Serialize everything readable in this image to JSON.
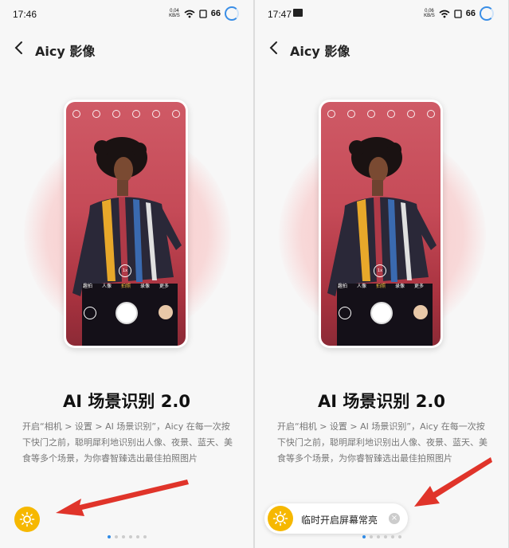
{
  "screens": [
    {
      "status": {
        "time": "17:46",
        "speed_value": "0.04",
        "speed_unit": "KB/S",
        "battery": "66"
      },
      "header": {
        "title": "Aicy 影像"
      },
      "phone_ui": {
        "modes": [
          "趣拍",
          "人像",
          "拍照",
          "录像",
          "更多"
        ],
        "active_mode": "拍照",
        "zoom": "1x"
      },
      "headline": "AI 场景识别 2.0",
      "description": "开启“相机 > 设置 > AI 场景识别”，Aicy 在每一次按下快门之前，聪明犀利地识别出人像、夜景、蓝天、美食等多个场景，为你睿智臻选出最佳拍照图片",
      "page_dots": 6,
      "active_dot": 0
    },
    {
      "status": {
        "time": "17:47",
        "speed_value": "0.06",
        "speed_unit": "KB/S",
        "battery": "66"
      },
      "header": {
        "title": "Aicy 影像"
      },
      "phone_ui": {
        "modes": [
          "趣拍",
          "人像",
          "拍照",
          "录像",
          "更多"
        ],
        "active_mode": "拍照",
        "zoom": "1x"
      },
      "headline": "AI 场景识别 2.0",
      "description": "开启“相机 > 设置 > AI 场景识别”，Aicy 在每一次按下快门之前，聪明犀利地识别出人像、夜景、蓝天、美食等多个场景，为你睿智臻选出最佳拍照图片",
      "toast": {
        "text": "临时开启屏幕常亮"
      },
      "page_dots": 6,
      "active_dot": 0
    }
  ],
  "colors": {
    "accent": "#2f8be6",
    "sun": "#f6b800",
    "arrow": "#e0342a"
  },
  "icons": [
    "back-arrow-icon",
    "wifi-icon",
    "sun-icon",
    "close-icon",
    "notification-icon"
  ]
}
